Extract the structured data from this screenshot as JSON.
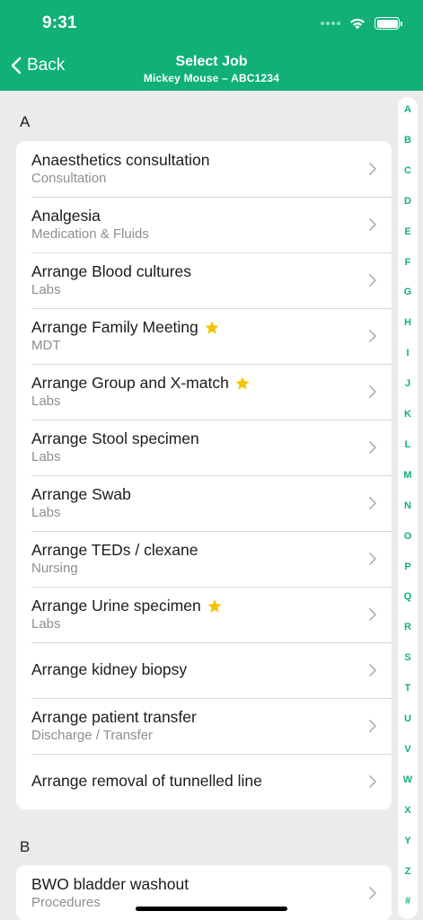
{
  "status": {
    "time": "9:31"
  },
  "nav": {
    "back_label": "Back",
    "title": "Select Job",
    "subtitle": "Mickey Mouse – ABC1234"
  },
  "colors": {
    "accent": "#10b077",
    "star": "#f5c400",
    "background": "#ebebeb"
  },
  "sections": [
    {
      "letter": "A",
      "items": [
        {
          "title": "Anaesthetics consultation",
          "subtitle": "Consultation",
          "starred": false
        },
        {
          "title": "Analgesia",
          "subtitle": "Medication & Fluids",
          "starred": false
        },
        {
          "title": "Arrange Blood cultures",
          "subtitle": "Labs",
          "starred": false
        },
        {
          "title": "Arrange Family Meeting",
          "subtitle": "MDT",
          "starred": true
        },
        {
          "title": "Arrange Group and X-match",
          "subtitle": "Labs",
          "starred": true
        },
        {
          "title": "Arrange Stool specimen",
          "subtitle": "Labs",
          "starred": false
        },
        {
          "title": "Arrange Swab",
          "subtitle": "Labs",
          "starred": false
        },
        {
          "title": "Arrange TEDs / clexane",
          "subtitle": "Nursing",
          "starred": false
        },
        {
          "title": "Arrange Urine specimen",
          "subtitle": "Labs",
          "starred": true
        },
        {
          "title": "Arrange kidney biopsy",
          "subtitle": "",
          "starred": false
        },
        {
          "title": "Arrange patient transfer",
          "subtitle": "Discharge / Transfer",
          "starred": false
        },
        {
          "title": "Arrange removal of tunnelled line",
          "subtitle": "",
          "starred": false
        }
      ]
    },
    {
      "letter": "B",
      "items": [
        {
          "title": "BWO bladder washout",
          "subtitle": "Procedures",
          "starred": false
        }
      ]
    }
  ],
  "index_letters": [
    "A",
    "B",
    "C",
    "D",
    "E",
    "F",
    "G",
    "H",
    "I",
    "J",
    "K",
    "L",
    "M",
    "N",
    "O",
    "P",
    "Q",
    "R",
    "S",
    "T",
    "U",
    "V",
    "W",
    "X",
    "Y",
    "Z",
    "#"
  ]
}
